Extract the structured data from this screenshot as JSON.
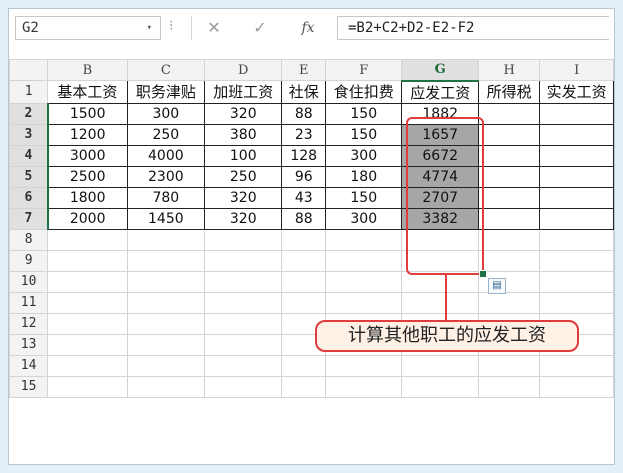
{
  "formula_bar": {
    "name_box": "G2",
    "dropdown_icon": "▾",
    "dots_icon": "⁝",
    "cancel_icon": "✕",
    "enter_icon": "✓",
    "fx_label": "fx",
    "formula": "=B2+C2+D2-E2-F2"
  },
  "columns": [
    "B",
    "C",
    "D",
    "E",
    "F",
    "G",
    "H",
    "I"
  ],
  "selected_column": "G",
  "header_row": [
    "基本工资",
    "职务津贴",
    "加班工资",
    "社保",
    "食住扣费",
    "应发工资",
    "所得税",
    "实发工资"
  ],
  "row_numbers": [
    "1",
    "2",
    "3",
    "4",
    "5",
    "6",
    "7",
    "8",
    "9",
    "10",
    "11",
    "12",
    "13",
    "14",
    "15"
  ],
  "data_rows": [
    [
      "1500",
      "300",
      "320",
      "88",
      "150",
      "1882",
      "",
      ""
    ],
    [
      "1200",
      "250",
      "380",
      "23",
      "150",
      "1657",
      "",
      ""
    ],
    [
      "3000",
      "4000",
      "100",
      "128",
      "300",
      "6672",
      "",
      ""
    ],
    [
      "2500",
      "2300",
      "250",
      "96",
      "180",
      "4774",
      "",
      ""
    ],
    [
      "1800",
      "780",
      "320",
      "43",
      "150",
      "2707",
      "",
      ""
    ],
    [
      "2000",
      "1450",
      "320",
      "88",
      "300",
      "3382",
      "",
      ""
    ]
  ],
  "quick_analysis_icon": "▤",
  "callout": "计算其他职工的应发工资",
  "colors": {
    "accent": "#217346",
    "highlight": "#e03c3c",
    "fill": "#a6a6a6",
    "background": "#e3f0f8"
  }
}
